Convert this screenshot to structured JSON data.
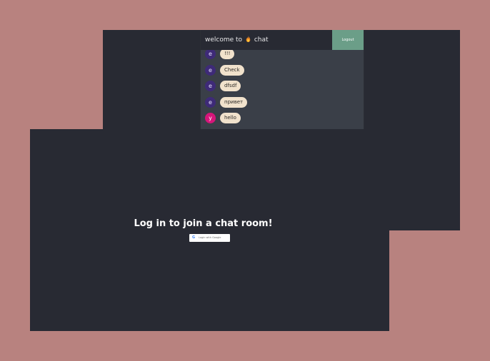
{
  "chat": {
    "title_prefix": "welcome to",
    "title_icon": "flame-icon",
    "title_suffix": "chat",
    "logout_label": "Logout",
    "messages": [
      {
        "avatar": "e",
        "text": "!!!",
        "avatar_color": "#3e2a78"
      },
      {
        "avatar": "e",
        "text": "Check",
        "avatar_color": "#3e2a78"
      },
      {
        "avatar": "e",
        "text": "dfsdf",
        "avatar_color": "#3e2a78"
      },
      {
        "avatar": "e",
        "text": "привет",
        "avatar_color": "#3e2a78"
      },
      {
        "avatar": "y",
        "text": "hello",
        "avatar_color": "#d6157a"
      }
    ]
  },
  "login": {
    "heading": "Log in to join a chat room!",
    "google_button_label": "Login with Google",
    "google_icon": "google-icon"
  },
  "colors": {
    "background": "#b8827f",
    "panel": "#282a33",
    "chat_area": "#3a3f48",
    "logout": "#6b9e88",
    "bubble": "#f1e2cc"
  }
}
